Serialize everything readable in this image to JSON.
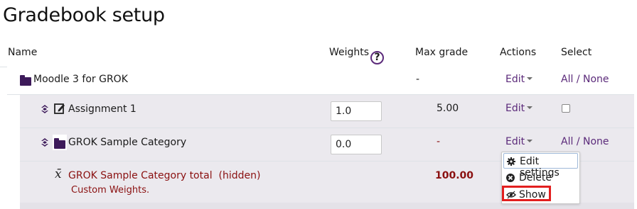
{
  "page": {
    "title": "Gradebook setup"
  },
  "columns": {
    "name": "Name",
    "weights": "Weights",
    "max_grade": "Max grade",
    "actions": "Actions",
    "select": "Select"
  },
  "rows": [
    {
      "type": "category",
      "name": "Moodle 3 for GROK",
      "max_grade": "-",
      "action": "Edit",
      "select": "All / None"
    },
    {
      "type": "assignment",
      "name": "Assignment 1",
      "weight": "1.0",
      "max_grade": "5.00",
      "action": "Edit"
    },
    {
      "type": "category",
      "name": "GROK Sample Category",
      "weight": "0.0",
      "max_grade": "-",
      "action": "Edit",
      "select": "All / None"
    },
    {
      "type": "total",
      "name": "GROK Sample Category total",
      "status": "(hidden)",
      "note": "Custom Weights.",
      "max_grade": "100.00"
    }
  ],
  "select_links": {
    "all": "All",
    "separator": "/",
    "none": "None"
  },
  "action_menu": {
    "items": [
      {
        "label": "Edit settings",
        "icon": "gear-icon"
      },
      {
        "label": "Delete",
        "icon": "x-circle-icon"
      },
      {
        "label": "Show",
        "icon": "eye-icon"
      }
    ]
  },
  "colors": {
    "accent": "#5b2a7a",
    "hidden_text": "#8a1010",
    "highlight": "#e21f1f",
    "row_bg": "#ebe9ee"
  }
}
